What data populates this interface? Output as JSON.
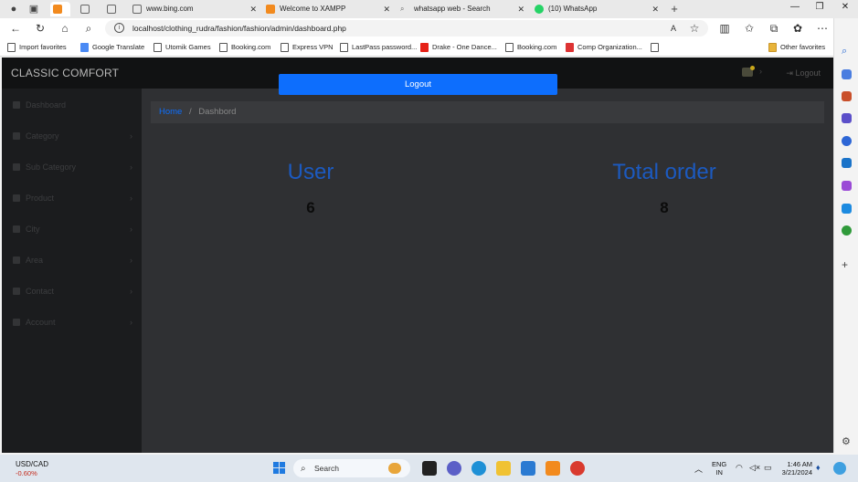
{
  "browser": {
    "tabs": [
      {
        "label": "",
        "active": true
      },
      {
        "label": "",
        "active": false
      },
      {
        "label": "",
        "active": false
      },
      {
        "label": "www.bing.com",
        "active": false
      },
      {
        "label": "Welcome to XAMPP",
        "active": false
      },
      {
        "label": "whatsapp web - Search",
        "active": false
      },
      {
        "label": "(10) WhatsApp",
        "active": false
      }
    ],
    "url": "localhost/clothing_rudra/fashion/fashion/admin/dashboard.php",
    "favorites": [
      "Import favorites",
      "Google Translate",
      "Utomik Games",
      "Booking.com",
      "Express VPN",
      "LastPass password...",
      "Drake - One Dance...",
      "Booking.com",
      "Comp Organization..."
    ],
    "other_favorites": "Other favorites"
  },
  "app": {
    "brand": "CLASSIC COMFORT",
    "logout_button": "Logout",
    "top_logout": "Logout",
    "sidebar": [
      {
        "label": "Dashboard",
        "has_arrow": false
      },
      {
        "label": "Category",
        "has_arrow": true
      },
      {
        "label": "Sub Category",
        "has_arrow": true
      },
      {
        "label": "Product",
        "has_arrow": true
      },
      {
        "label": "City",
        "has_arrow": true
      },
      {
        "label": "Area",
        "has_arrow": true
      },
      {
        "label": "Contact",
        "has_arrow": true
      },
      {
        "label": "Account",
        "has_arrow": true
      }
    ],
    "breadcrumb": {
      "home": "Home",
      "separator": "/",
      "current": "Dashbord"
    },
    "stats": [
      {
        "title": "User",
        "value": "6"
      },
      {
        "title": "Total order",
        "value": "8"
      }
    ],
    "accent_color": "#0d6efd"
  },
  "taskbar": {
    "ticker_name": "USD/CAD",
    "ticker_change": "-0.60%",
    "search_placeholder": "Search",
    "lang_line1": "ENG",
    "lang_line2": "IN",
    "time": "1:46 AM",
    "date": "3/21/2024"
  }
}
